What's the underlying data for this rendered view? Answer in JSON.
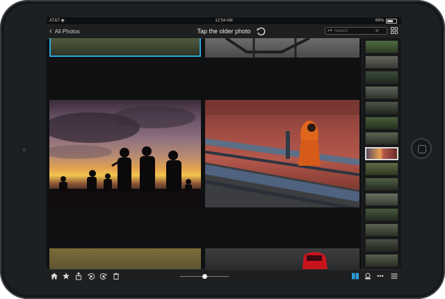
{
  "status_bar": {
    "carrier": "AT&T",
    "time": "12:54 AM",
    "battery": "69%"
  },
  "nav": {
    "back_label": "All Photos",
    "title": "Tap the older photo"
  },
  "search": {
    "placeholder": "Search"
  },
  "toolbar": {
    "zoom_level": 0.5
  },
  "colors": {
    "selection": "#2aa7e0",
    "accent_blue": "#2f9bd8"
  },
  "icons": {
    "home": "home-icon",
    "star": "star-icon",
    "share": "share-icon",
    "rotate_left": "rotate-left-icon",
    "rotate_right": "rotate-right-icon",
    "trash": "trash-icon",
    "view_toggle": "view-toggle-icon",
    "stamp": "stamp-icon",
    "more": "more-icon",
    "menu": "menu-icon"
  }
}
